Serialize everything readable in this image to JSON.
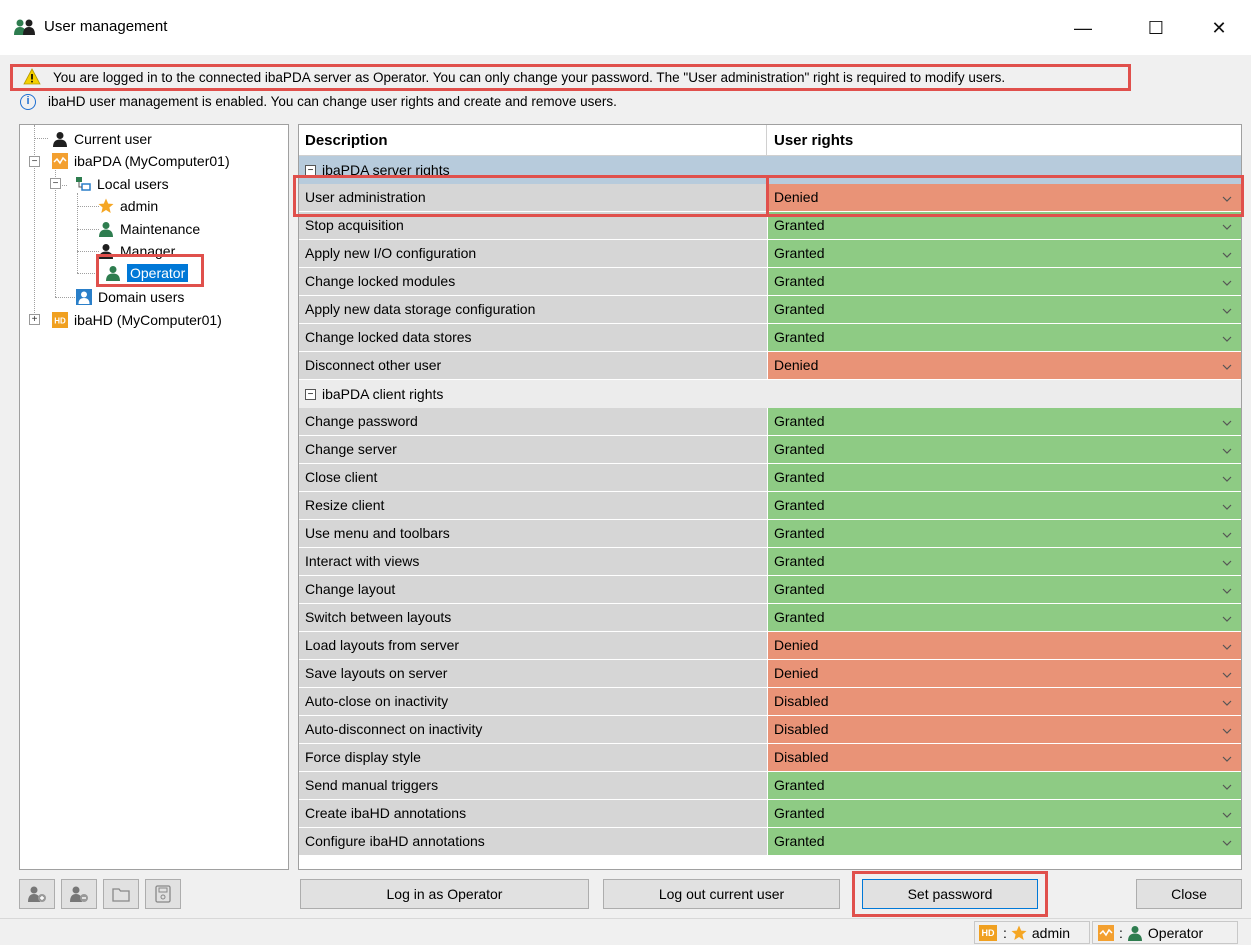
{
  "window": {
    "title": "User management",
    "minimize": "—",
    "maximize": "☐",
    "close": "✕"
  },
  "messages": {
    "warning": "You are logged in to the connected ibaPDA server as Operator. You can only change your password. The \"User administration\" right is required to modify users.",
    "info": "ibaHD user management is enabled. You can change user rights and create and remove users."
  },
  "tree": {
    "current_user": "Current user",
    "ibapda": "ibaPDA (MyComputer01)",
    "local_users": "Local users",
    "users": [
      "admin",
      "Maintenance",
      "Manager",
      "Operator"
    ],
    "domain_users": "Domain users",
    "ibahd": "ibaHD (MyComputer01)",
    "selected": "Operator"
  },
  "grid": {
    "col_description": "Description",
    "col_rights": "User rights",
    "server_group": "ibaPDA server rights",
    "server_rows": [
      {
        "desc": "User administration",
        "value": "Denied",
        "state": "denied"
      },
      {
        "desc": "Stop acquisition",
        "value": "Granted",
        "state": "granted"
      },
      {
        "desc": "Apply new I/O configuration",
        "value": "Granted",
        "state": "granted"
      },
      {
        "desc": "Change locked modules",
        "value": "Granted",
        "state": "granted"
      },
      {
        "desc": "Apply new data storage configuration",
        "value": "Granted",
        "state": "granted"
      },
      {
        "desc": "Change locked data stores",
        "value": "Granted",
        "state": "granted"
      },
      {
        "desc": "Disconnect other user",
        "value": "Denied",
        "state": "denied"
      }
    ],
    "client_group": "ibaPDA client rights",
    "client_rows": [
      {
        "desc": "Change password",
        "value": "Granted",
        "state": "granted"
      },
      {
        "desc": "Change server",
        "value": "Granted",
        "state": "granted"
      },
      {
        "desc": "Close client",
        "value": "Granted",
        "state": "granted"
      },
      {
        "desc": "Resize client",
        "value": "Granted",
        "state": "granted"
      },
      {
        "desc": "Use menu and toolbars",
        "value": "Granted",
        "state": "granted"
      },
      {
        "desc": "Interact with views",
        "value": "Granted",
        "state": "granted"
      },
      {
        "desc": "Change layout",
        "value": "Granted",
        "state": "granted"
      },
      {
        "desc": "Switch between layouts",
        "value": "Granted",
        "state": "granted"
      },
      {
        "desc": "Load layouts from server",
        "value": "Denied",
        "state": "denied"
      },
      {
        "desc": "Save layouts on server",
        "value": "Denied",
        "state": "denied"
      },
      {
        "desc": "Auto-close on inactivity",
        "value": "Disabled",
        "state": "denied"
      },
      {
        "desc": "Auto-disconnect on inactivity",
        "value": "Disabled",
        "state": "denied"
      },
      {
        "desc": "Force display style",
        "value": "Disabled",
        "state": "denied"
      },
      {
        "desc": "Send manual triggers",
        "value": "Granted",
        "state": "granted"
      },
      {
        "desc": "Create ibaHD annotations",
        "value": "Granted",
        "state": "granted"
      },
      {
        "desc": "Configure ibaHD annotations",
        "value": "Granted",
        "state": "granted"
      }
    ]
  },
  "buttons": {
    "login": "Log in as Operator",
    "logout": "Log out current user",
    "set_password": "Set password",
    "close": "Close"
  },
  "statusbar": {
    "hd_badge": "HD",
    "hd_sep": ":",
    "hd_user": "admin",
    "pda_sep": ":",
    "pda_user": "Operator"
  },
  "colors": {
    "granted": "#8ecb84",
    "denied": "#e99377",
    "highlight": "#e0504c",
    "selection": "#0078d7"
  }
}
